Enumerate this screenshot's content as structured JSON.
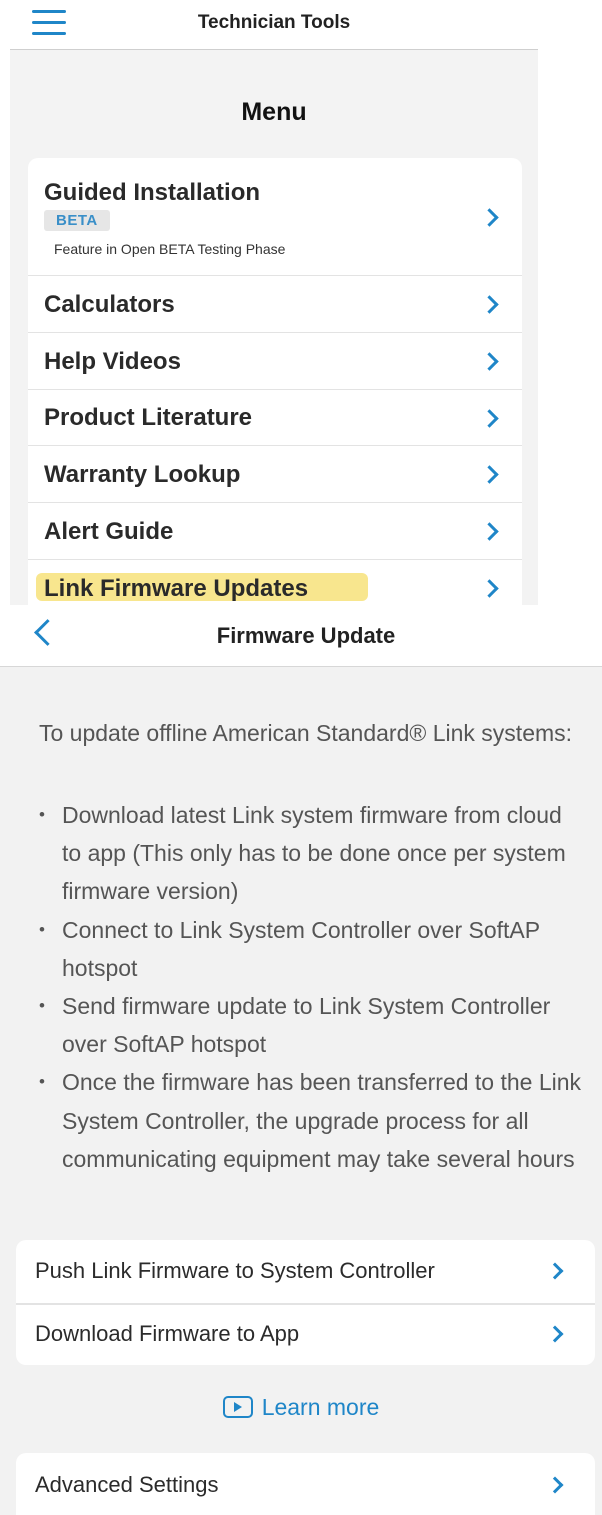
{
  "screen1": {
    "header": {
      "title": "Technician Tools"
    },
    "menu_heading": "Menu",
    "items": [
      {
        "label": "Guided Installation",
        "badge": "BETA",
        "note": "Feature in Open BETA Testing Phase"
      },
      {
        "label": "Calculators"
      },
      {
        "label": "Help Videos"
      },
      {
        "label": "Product Literature"
      },
      {
        "label": "Warranty Lookup"
      },
      {
        "label": "Alert Guide"
      },
      {
        "label": "Link Firmware Updates",
        "highlighted": true
      }
    ],
    "highlight_color": "#f7e27a"
  },
  "screen2": {
    "header": {
      "title": "Firmware Update"
    },
    "intro": "To update offline American Standard® Link systems:",
    "bullets": [
      "Download latest Link system firmware from cloud to app (This only has to be done once per system firmware version)",
      "Connect to Link System Controller over SoftAP hotspot",
      "Send firmware update to Link System Controller over SoftAP hotspot",
      "Once the firmware has been transferred to the Link System Controller, the upgrade process for all communicating equipment may take several hours"
    ],
    "actions": [
      {
        "label": "Push Link Firmware to System Controller"
      },
      {
        "label": "Download Firmware to App"
      }
    ],
    "learn_more": "Learn more",
    "advanced": {
      "label": "Advanced Settings"
    }
  },
  "colors": {
    "accent": "#1f86c8",
    "background": "#f2f2f2"
  },
  "icons": [
    "hamburger-menu-icon",
    "chevron-right-icon",
    "back-chevron-icon",
    "play-video-icon"
  ]
}
